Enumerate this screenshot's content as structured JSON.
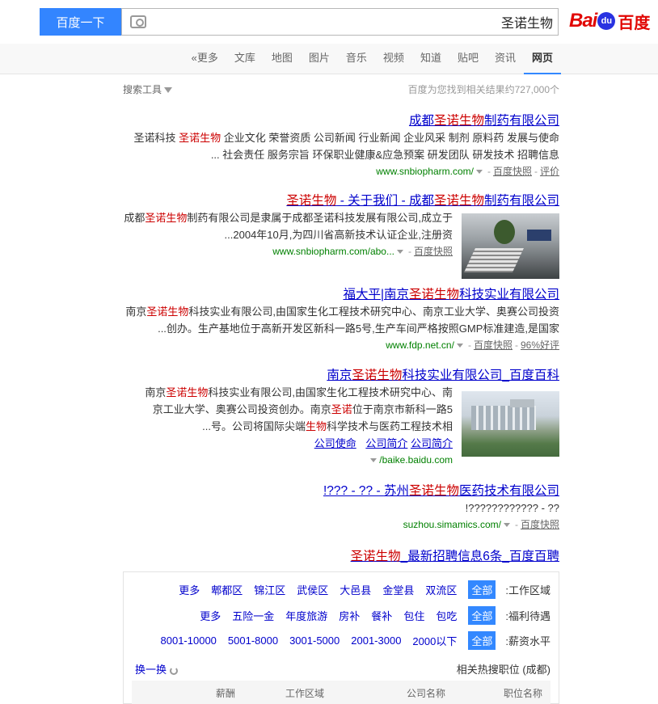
{
  "header": {
    "logo_text_en": "Bai",
    "logo_text_paw": "du",
    "logo_text_cn": "百度",
    "search_value": "圣诺生物",
    "search_button": "百度一下"
  },
  "tabs": [
    {
      "label": "网页",
      "active": true
    },
    {
      "label": "资讯"
    },
    {
      "label": "贴吧"
    },
    {
      "label": "知道"
    },
    {
      "label": "视频"
    },
    {
      "label": "音乐"
    },
    {
      "label": "图片"
    },
    {
      "label": "地图"
    },
    {
      "label": "文库"
    },
    {
      "label": "更多»"
    }
  ],
  "info": {
    "count": "百度为您找到相关结果约727,000个",
    "tools": "搜索工具"
  },
  "results": [
    {
      "title_pre": "成都",
      "title_em": "圣诺生物",
      "title_post": "制药有限公司",
      "abs1_pre": "圣诺科技 ",
      "abs1_em": "圣诺生物",
      "abs1_post": " 企业文化 荣誉资质 公司新闻 行业新闻 企业风采 制剂 原料药 发展与使命",
      "abs2": "社会责任 服务宗旨 环保职业健康&应急预案 研发团队 研发技术 招聘信息 ...",
      "url": "www.snbiopharm.com/",
      "cache": "百度快照",
      "extra": "评价"
    },
    {
      "title_em1": "圣诺生物",
      "title_mid": " - 关于我们 - 成都",
      "title_em2": "圣诺生物",
      "title_post": "制药有限公司",
      "abs1_pre": "成都",
      "abs1_em": "圣诺生物",
      "abs1_post": "制药有限公司是隶属于成都圣诺科技发展有限公司,成立于",
      "abs2": "2004年10月,为四川省高新技术认证企业,注册资...",
      "url": "www.snbiopharm.com/abo...",
      "cache": "百度快照"
    },
    {
      "title_pre": "福大平|南京",
      "title_em": "圣诺生物",
      "title_post": "科技实业有限公司",
      "abs1_pre": "南京",
      "abs1_em": "圣诺生物",
      "abs1_post": "科技实业有限公司,由国家生化工程技术研究中心、南京工业大学、奥赛公司投资",
      "abs2": "创办。生产基地位于高新开发区新科一路5号,生产车间严格按照GMP标准建造,是国家...",
      "url": "www.fdp.net.cn/",
      "cache": "百度快照",
      "extra": "96%好评"
    },
    {
      "title_pre": "南京",
      "title_em": "圣诺生物",
      "title_post": "科技实业有限公司_百度百科",
      "abs1_pre": "南京",
      "abs1_em": "圣诺生物",
      "abs1_post": "科技实业有限公司,由国家生化工程技术研究中心、南",
      "abs2_pre": "京工业大学、奥赛公司投资创办。南京",
      "abs2_em": "圣诺",
      "abs2_post": "位于南京市新科一路5",
      "abs3_pre": "号。公司将国际尖端",
      "abs3_em": "生物",
      "abs3_post": "科学技术与医药工程技术相...",
      "links": [
        "公司使命",
        "公司简介",
        "公司简介"
      ],
      "url": "baike.baidu.com/"
    },
    {
      "title_pre": "苏州",
      "title_em": "圣诺生物",
      "title_post": "医药技术有限公司 - ?? - ???!",
      "abs1": "?? - ????????????!",
      "url": "suzhou.simamics.com/",
      "cache": "百度快照"
    }
  ],
  "recruit": {
    "title_em": "圣诺生物",
    "title_post": "_最新招聘信息6条_百度百聘",
    "row1_label": "工作区域:",
    "row1_opts": [
      "全部",
      "双流区",
      "金堂县",
      "大邑县",
      "武侯区",
      "锦江区",
      "郫都区",
      "更多"
    ],
    "row2_label": "福利待遇:",
    "row2_opts": [
      "全部",
      "包吃",
      "包住",
      "餐补",
      "房补",
      "年度旅游",
      "五险一金",
      "更多"
    ],
    "row3_label": "薪资水平:",
    "row3_opts": [
      "全部",
      "2000以下",
      "2001-3000",
      "3001-5000",
      "5001-8000",
      "8001-10000"
    ],
    "hot_label": "相关热搜职位 (成都)",
    "refresh": "换一换",
    "cols": [
      "职位名称",
      "公司名称",
      "工作区域",
      "薪酬"
    ]
  }
}
